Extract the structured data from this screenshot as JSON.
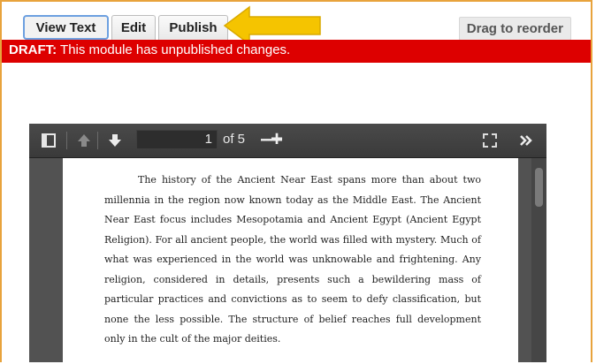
{
  "tabs": {
    "view_text": "View Text",
    "edit": "Edit",
    "publish": "Publish"
  },
  "drag_button": "Drag to reorder",
  "draft_notice": {
    "label": "DRAFT:",
    "message": " This module has unpublished changes."
  },
  "annotation_arrow": {
    "color": "#f5c400",
    "points_to": "publish-tab"
  },
  "pdf_viewer": {
    "toolbar": {
      "sidebar_toggle_icon": "sidebar-toggle-icon",
      "prev_page_icon": "arrow-up-icon",
      "next_page_icon": "arrow-down-icon",
      "page_number": "1",
      "page_count_text": "of 5",
      "zoom_out": "—",
      "zoom_in": "+",
      "fullscreen_icon": "fullscreen-icon",
      "tools_icon": "double-chevron-right-icon"
    },
    "page_text": "The history of the Ancient Near East spans more than about two millennia in the region now known today as the Middle East. The Ancient Near East focus includes Mesopotamia and Ancient Egypt (Ancient Egypt Religion).  For all ancient people, the world was filled with mystery. Much of what was experienced in the world was unknowable and frightening.  Any religion, considered in details, presents such a bewildering mass of particular practices and convictions as to seem to defy classification, but none the less possible. The structure of belief reaches full development only in the cult of the major deities."
  },
  "colors": {
    "module_border": "#e8a33c",
    "draft_bar": "#dd0000",
    "active_tab_border": "#6da0e0",
    "viewer_background": "#525252"
  }
}
